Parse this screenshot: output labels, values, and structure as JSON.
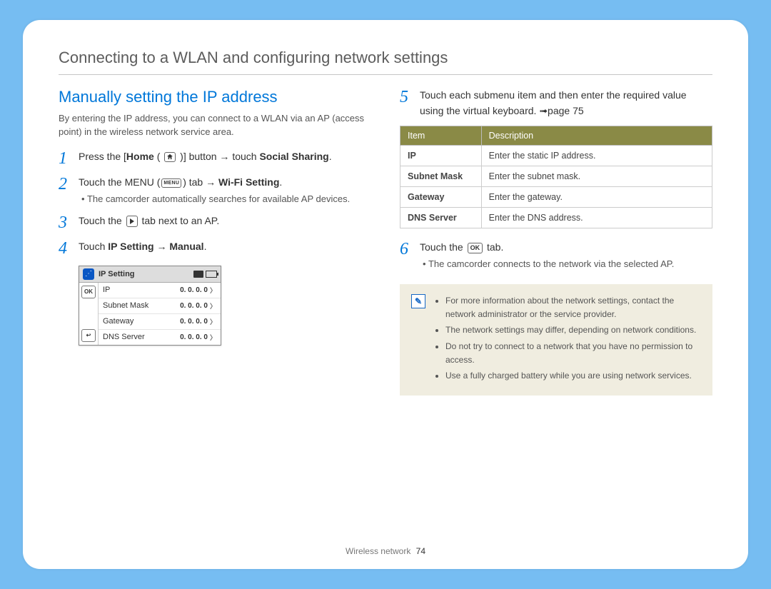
{
  "chapter_title": "Connecting to a WLAN and configuring network settings",
  "section_title": "Manually setting the IP address",
  "intro": "By entering the IP address, you can connect to a WLAN via an AP (access point) in the wireless network service area.",
  "steps": {
    "s1": {
      "num": "1",
      "pre": "Press the [",
      "home": "Home",
      "mid": " ( ",
      "post": " )] button → touch ",
      "tail_bold": "Social Sharing",
      "end": "."
    },
    "s2": {
      "num": "2",
      "pre": "Touch the MENU (",
      "post": ") tab → ",
      "bold": "Wi-Fi Setting",
      "end": ".",
      "sub": "The camcorder automatically searches for available AP devices."
    },
    "s3": {
      "num": "3",
      "pre": "Touch the ",
      "post": " tab next to an AP."
    },
    "s4": {
      "num": "4",
      "pre": "Touch ",
      "b1": "IP Setting",
      "arrow": " → ",
      "b2": "Manual",
      "end": "."
    },
    "s5": {
      "num": "5",
      "text": "Touch each submenu item and then enter the required value using the virtual keyboard. ➟page 75"
    },
    "s6": {
      "num": "6",
      "pre": "Touch the ",
      "post": " tab.",
      "sub": "The camcorder connects to the network via the selected AP."
    }
  },
  "screen": {
    "title": "IP Setting",
    "ok": "OK",
    "back": "↩",
    "rows": [
      {
        "label": "IP",
        "value": "0. 0. 0. 0"
      },
      {
        "label": "Subnet Mask",
        "value": "0. 0. 0. 0"
      },
      {
        "label": "Gateway",
        "value": "0. 0. 0. 0"
      },
      {
        "label": "DNS Server",
        "value": "0. 0. 0. 0"
      }
    ]
  },
  "table": {
    "h1": "Item",
    "h2": "Description",
    "rows": [
      {
        "item": "IP",
        "desc": "Enter the static IP address."
      },
      {
        "item": "Subnet Mask",
        "desc": "Enter the subnet mask."
      },
      {
        "item": "Gateway",
        "desc": "Enter the gateway."
      },
      {
        "item": "DNS Server",
        "desc": "Enter the DNS address."
      }
    ]
  },
  "notes": [
    "For more information about the network settings, contact the network administrator or the service provider.",
    "The network settings may differ, depending on network conditions.",
    "Do not try to connect to a network that you have no permission to access.",
    "Use a fully charged battery while you are using network services."
  ],
  "footer": {
    "section": "Wireless network",
    "page": "74"
  },
  "icons": {
    "menu_label": "MENU",
    "ok_label": "OK"
  }
}
